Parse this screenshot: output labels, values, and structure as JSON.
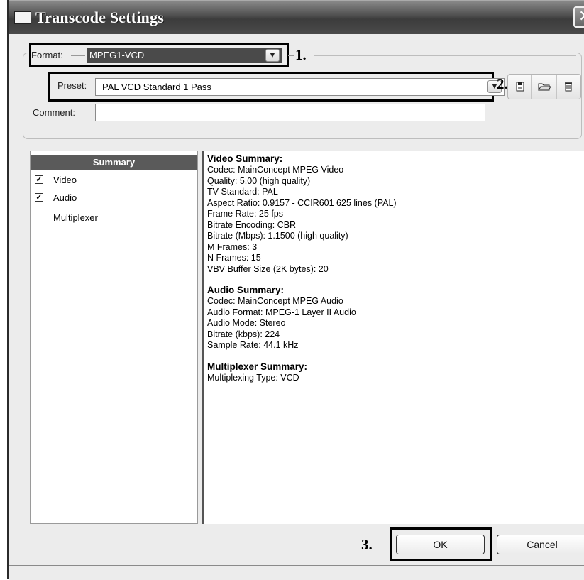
{
  "window": {
    "title": "Transcode Settings",
    "close_symbol": "✕"
  },
  "format": {
    "label": "Format:",
    "value": "MPEG1-VCD",
    "annotation": "1."
  },
  "preset": {
    "label": "Preset:",
    "value": "PAL VCD Standard 1 Pass",
    "annotation": "2.",
    "tool_icons": [
      "save-icon",
      "open-folder-icon",
      "delete-icon"
    ]
  },
  "comment": {
    "label": "Comment:",
    "value": ""
  },
  "nav": {
    "items": [
      {
        "label": "Summary",
        "selected": true,
        "checkbox": false
      },
      {
        "label": "Video",
        "selected": false,
        "checkbox": true,
        "checked": true
      },
      {
        "label": "Audio",
        "selected": false,
        "checkbox": true,
        "checked": true
      },
      {
        "label": "Multiplexer",
        "selected": false,
        "checkbox": false
      }
    ]
  },
  "summary": {
    "video": {
      "heading": "Video Summary:",
      "lines": [
        "Codec: MainConcept MPEG Video",
        "Quality: 5.00 (high quality)",
        "TV Standard: PAL",
        "Aspect Ratio: 0.9157 - CCIR601 625 lines (PAL)",
        "Frame Rate: 25 fps",
        "Bitrate Encoding: CBR",
        "Bitrate (Mbps): 1.1500 (high quality)",
        "M Frames: 3",
        "N Frames: 15",
        "VBV Buffer Size (2K bytes): 20"
      ]
    },
    "audio": {
      "heading": "Audio Summary:",
      "lines": [
        "Codec: MainConcept MPEG Audio",
        "Audio Format: MPEG-1 Layer II Audio",
        "Audio Mode: Stereo",
        "Bitrate (kbps): 224",
        "Sample Rate: 44.1 kHz"
      ]
    },
    "multiplexer": {
      "heading": "Multiplexer Summary:",
      "lines": [
        "Multiplexing Type: VCD"
      ]
    }
  },
  "buttons": {
    "ok": "OK",
    "cancel": "Cancel",
    "annotation": "3."
  }
}
